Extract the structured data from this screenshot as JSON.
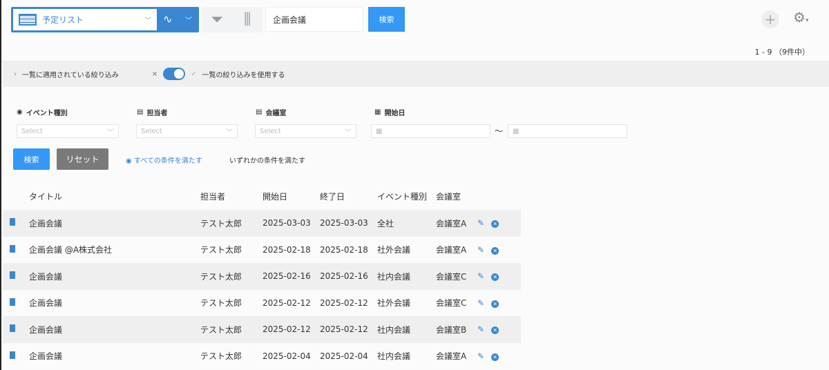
{
  "header": {
    "view_name": "予定リスト",
    "keyword": "企画会議",
    "search_label": "検索",
    "pagination": "1 - 9 （9件中）"
  },
  "filterbar": {
    "applied_label": "一覧に適用されている絞り込み",
    "use_label": "一覧の絞り込みを使用する",
    "toggle_on": true
  },
  "filters": [
    {
      "label": "イベント種別",
      "placeholder": "Select"
    },
    {
      "label": "担当者",
      "placeholder": "Select"
    },
    {
      "label": "会議室",
      "placeholder": "Select"
    },
    {
      "label": "開始日",
      "range_sep": "〜"
    }
  ],
  "actions": {
    "search": "検索",
    "reset": "リセット",
    "all_label": "すべての条件を満たす",
    "any_label": "いずれかの条件を満たす"
  },
  "table": {
    "headers": [
      "タイトル",
      "担当者",
      "開始日",
      "終了日",
      "イベント種別",
      "会議室"
    ],
    "rows": [
      [
        "企画会議",
        "テスト太郎",
        "2025-03-03",
        "2025-03-03",
        "全社",
        "会議室A"
      ],
      [
        "企画会議 @A株式会社",
        "テスト太郎",
        "2025-02-18",
        "2025-02-18",
        "社外会議",
        "会議室A"
      ],
      [
        "企画会議",
        "テスト太郎",
        "2025-02-16",
        "2025-02-16",
        "社内会議",
        "会議室C"
      ],
      [
        "企画会議",
        "テスト太郎",
        "2025-02-12",
        "2025-02-12",
        "社外会議",
        "会議室C"
      ],
      [
        "企画会議",
        "テスト太郎",
        "2025-02-12",
        "2025-02-12",
        "社内会議",
        "会議室B"
      ],
      [
        "企画会議",
        "テスト太郎",
        "2025-02-04",
        "2025-02-04",
        "社内会議",
        "会議室A"
      ]
    ]
  }
}
